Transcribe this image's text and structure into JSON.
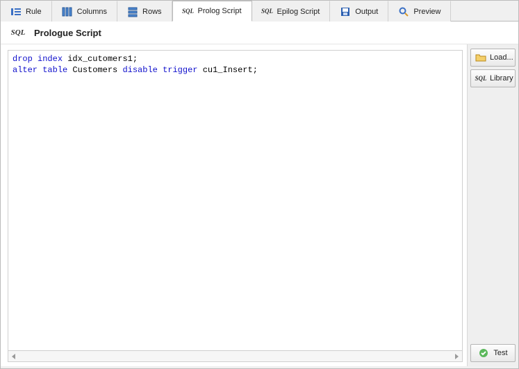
{
  "tabs": [
    {
      "label": "Rule"
    },
    {
      "label": "Columns"
    },
    {
      "label": "Rows"
    },
    {
      "label": "Prolog Script"
    },
    {
      "label": "Epilog Script"
    },
    {
      "label": "Output"
    },
    {
      "label": "Preview"
    }
  ],
  "active_tab_index": 3,
  "header": {
    "title": "Prologue Script"
  },
  "editor": {
    "tokens": [
      {
        "t": "drop",
        "kw": true
      },
      {
        "t": " "
      },
      {
        "t": "index",
        "kw": true
      },
      {
        "t": " idx_cutomers1;\n"
      },
      {
        "t": "alter",
        "kw": true
      },
      {
        "t": " "
      },
      {
        "t": "table",
        "kw": true
      },
      {
        "t": " Customers "
      },
      {
        "t": "disable",
        "kw": true
      },
      {
        "t": " "
      },
      {
        "t": "trigger",
        "kw": true
      },
      {
        "t": " cu1_Insert;"
      }
    ]
  },
  "buttons": {
    "load": "Load...",
    "library": "Library",
    "test": "Test"
  }
}
